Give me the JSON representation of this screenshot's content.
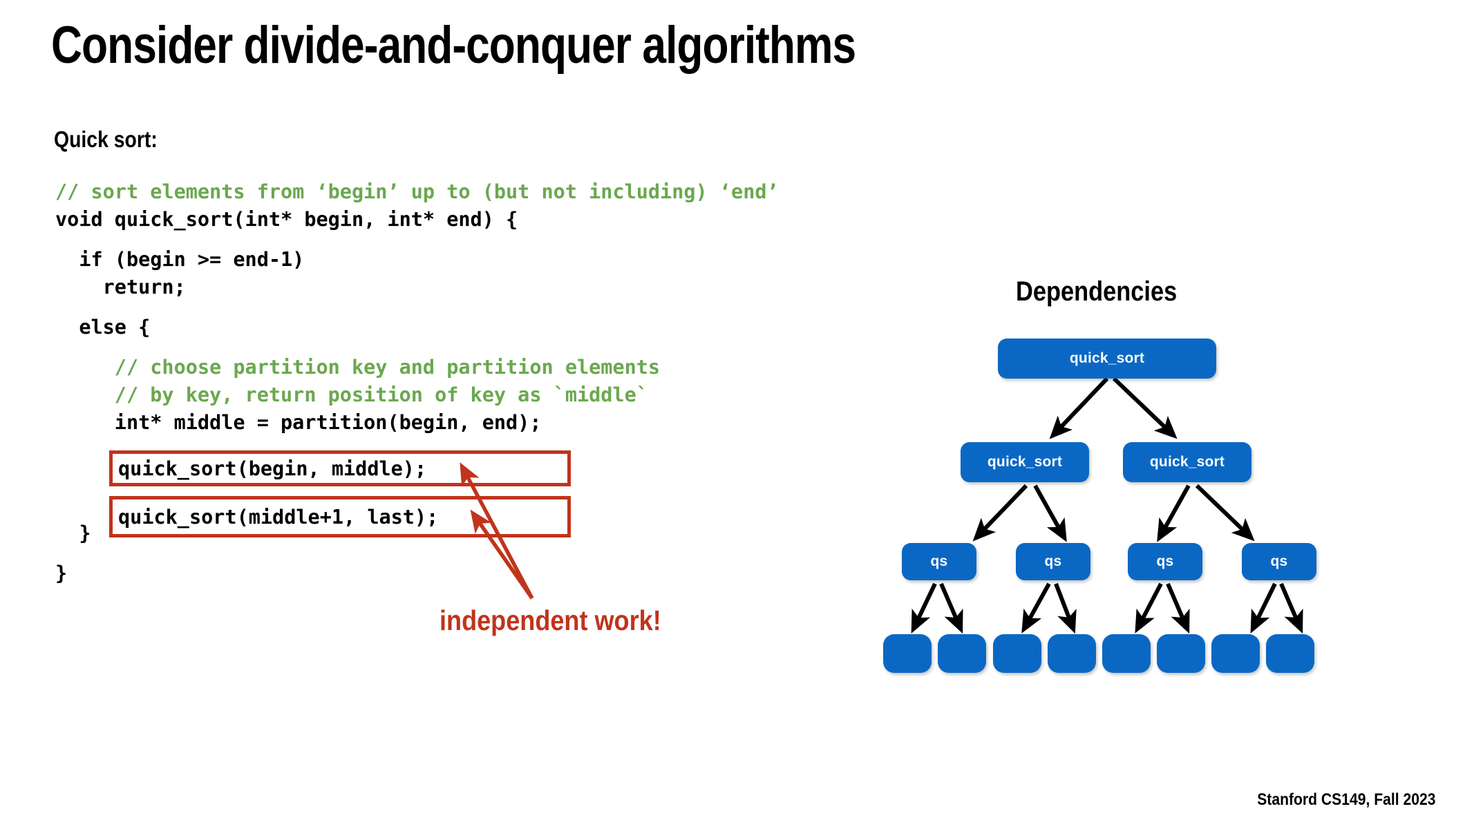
{
  "slide": {
    "title": "Consider divide-and-conquer algorithms",
    "subhead": "Quick sort:",
    "footer": "Stanford CS149, Fall 2023",
    "background_color": "#ffffff"
  },
  "code": {
    "comment_color": "#6aa84f",
    "text_color": "#000000",
    "lines": [
      {
        "text": "// sort elements from ‘begin’ up to (but not including) ‘end’",
        "kind": "comment",
        "gap": false
      },
      {
        "text": "void quick_sort(int* begin, int* end) {",
        "kind": "code",
        "gap": false
      },
      {
        "text": "  if (begin >= end-1)",
        "kind": "code",
        "gap": true
      },
      {
        "text": "    return;",
        "kind": "code",
        "gap": false
      },
      {
        "text": "  else {",
        "kind": "code",
        "gap": true
      },
      {
        "text": "     // choose partition key and partition elements",
        "kind": "comment",
        "gap": true
      },
      {
        "text": "     // by key, return position of key as `middle`",
        "kind": "comment",
        "gap": false
      },
      {
        "text": "     int* middle = partition(begin, end);",
        "kind": "code",
        "gap": false
      },
      {
        "text": "",
        "kind": "code",
        "gap": false
      },
      {
        "text": "",
        "kind": "code",
        "gap": false
      },
      {
        "text": "",
        "kind": "code",
        "gap": false
      },
      {
        "text": "  }",
        "kind": "code",
        "gap": false
      },
      {
        "text": "}",
        "kind": "code",
        "gap": true
      }
    ]
  },
  "highlight": {
    "border_color": "#c0341b",
    "boxes": [
      {
        "text": "quick_sort(begin, middle);"
      },
      {
        "text": "quick_sort(middle+1, last);"
      }
    ],
    "callout_label": "independent work!",
    "callout_color": "#c0341b"
  },
  "dependencies": {
    "title": "Dependencies",
    "node_color": "#0a68c4",
    "node_text_color": "#ffffff",
    "edge_color": "#000000",
    "levels": [
      {
        "level": 0,
        "labels": [
          "quick_sort"
        ]
      },
      {
        "level": 1,
        "labels": [
          "quick_sort",
          "quick_sort"
        ]
      },
      {
        "level": 2,
        "labels": [
          "qs",
          "qs",
          "qs",
          "qs"
        ]
      },
      {
        "level": 3,
        "labels": [
          "",
          "",
          "",
          "",
          "",
          "",
          "",
          ""
        ]
      }
    ]
  }
}
